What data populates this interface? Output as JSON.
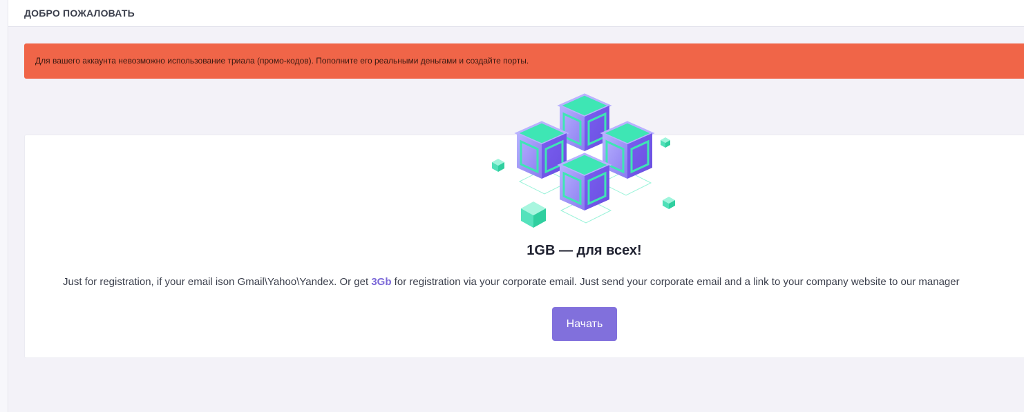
{
  "header": {
    "title": "ДОБРО ПОЖАЛОВАТЬ"
  },
  "alert": {
    "text": "Для вашего аккаунта невозможно использование триала (промо-кодов). Пополните его реальными деньгами и создайте порты."
  },
  "card": {
    "illustration_icon": "cubes-illustration-icon",
    "title": "1GB — для всех!",
    "desc_before": "Just for registration, if your email is",
    "desc_on": "on Gmail\\Yahoo\\Yandex. Or get ",
    "desc_highlight": "3Gb",
    "desc_after": " for registration via your corporate email. Just send your corporate email and a link to your company website to our manager",
    "start_button_label": "Начать"
  },
  "colors": {
    "alert_bg": "#f06548",
    "accent": "#8170dc",
    "cube_green": "#3ee6b4",
    "cube_purple": "#7b61e8"
  }
}
